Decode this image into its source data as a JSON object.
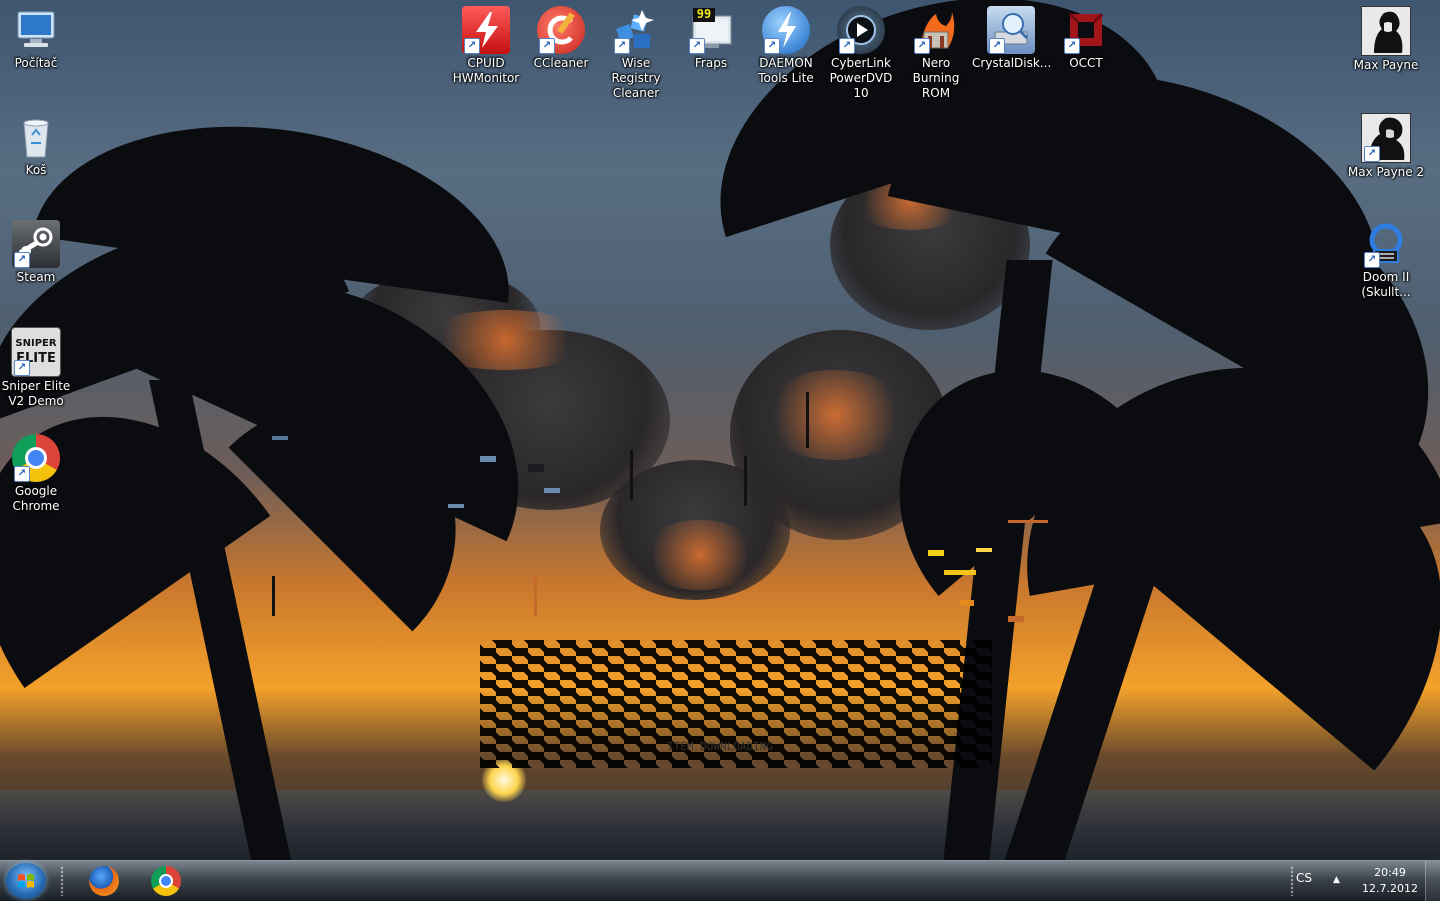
{
  "desktop_icons_left": [
    {
      "label": "Počítač",
      "icon": "computer-icon"
    },
    {
      "label": "Koš",
      "icon": "recycle-bin-icon"
    },
    {
      "label": "Steam",
      "icon": "steam-icon"
    },
    {
      "label": "Sniper Elite V2 Demo",
      "icon": "sniper-elite-icon"
    },
    {
      "label": "Google Chrome",
      "icon": "chrome-icon"
    }
  ],
  "desktop_icons_top": [
    {
      "label": "CPUID HWMonitor",
      "icon": "hwmonitor-icon"
    },
    {
      "label": "CCleaner",
      "icon": "ccleaner-icon"
    },
    {
      "label": "Wise Registry Cleaner",
      "icon": "wise-registry-icon"
    },
    {
      "label": "Fraps",
      "icon": "fraps-icon",
      "badge": "99"
    },
    {
      "label": "DAEMON Tools Lite",
      "icon": "daemon-tools-icon"
    },
    {
      "label": "CyberLink PowerDVD 10",
      "icon": "powerdvd-icon"
    },
    {
      "label": "Nero Burning ROM",
      "icon": "nero-icon"
    },
    {
      "label": "CrystalDisk...",
      "icon": "crystaldisk-icon"
    },
    {
      "label": "OCCT",
      "icon": "occt-icon"
    }
  ],
  "desktop_icons_right": [
    {
      "label": "Max Payne",
      "icon": "max-payne-icon"
    },
    {
      "label": "Max Payne 2",
      "icon": "max-payne-2-icon"
    },
    {
      "label": "Doom II (Skullt...",
      "icon": "doom-icon"
    }
  ],
  "glitch_text": "ITEM DOWNLOADING",
  "taskbar": {
    "pinned": [
      {
        "name": "Firefox",
        "icon": "firefox-icon"
      },
      {
        "name": "Google Chrome",
        "icon": "chrome-icon"
      }
    ],
    "tray": {
      "language": "CS",
      "time": "20:49",
      "date": "12.7.2012"
    }
  },
  "colors": {
    "sunset": "#f3a12a",
    "sky": "#4f6377",
    "taskbar": "#1f262d"
  }
}
